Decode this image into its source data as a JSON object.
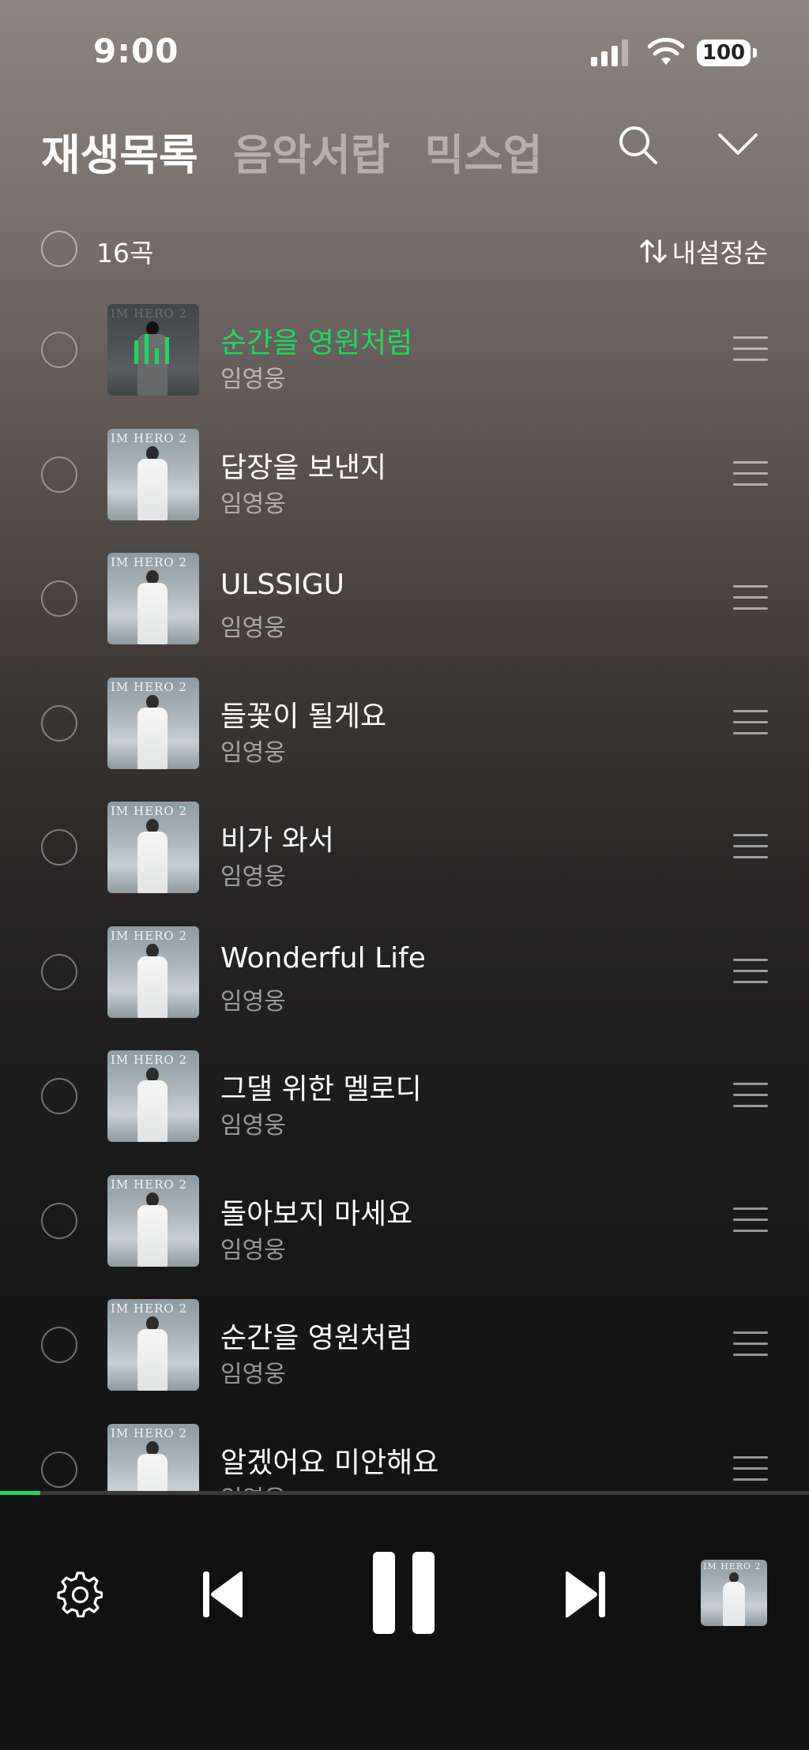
{
  "status_bar": {
    "time": "9:00",
    "battery": "100"
  },
  "header": {
    "tabs": [
      {
        "label": "재생목록",
        "active": true
      },
      {
        "label": "음악서랍",
        "active": false
      },
      {
        "label": "믹스업",
        "active": false
      }
    ],
    "search_icon": "search-icon",
    "collapse_icon": "chevron-down-icon"
  },
  "list_header": {
    "count": "16곡",
    "sort_label": "내설정순"
  },
  "album_art_text": "IM HERO 2",
  "tracks": [
    {
      "title": "순간을 영원처럼",
      "artist": "임영웅",
      "playing": true
    },
    {
      "title": "답장을 보낸지",
      "artist": "임영웅",
      "playing": false
    },
    {
      "title": "ULSSIGU",
      "artist": "임영웅",
      "playing": false
    },
    {
      "title": "들꽃이 될게요",
      "artist": "임영웅",
      "playing": false
    },
    {
      "title": "비가 와서",
      "artist": "임영웅",
      "playing": false
    },
    {
      "title": "Wonderful Life",
      "artist": "임영웅",
      "playing": false
    },
    {
      "title": "그댈 위한 멜로디",
      "artist": "임영웅",
      "playing": false
    },
    {
      "title": "돌아보지 마세요",
      "artist": "임영웅",
      "playing": false
    },
    {
      "title": "순간을 영원처럼",
      "artist": "임영웅",
      "playing": false
    },
    {
      "title": "알겠어요 미안해요",
      "artist": "임영웅",
      "playing": false
    }
  ],
  "player": {
    "progress": 0.05,
    "accent_color": "#1ed760",
    "controls": [
      "gear-icon",
      "previous-icon",
      "pause-icon",
      "next-icon"
    ]
  }
}
